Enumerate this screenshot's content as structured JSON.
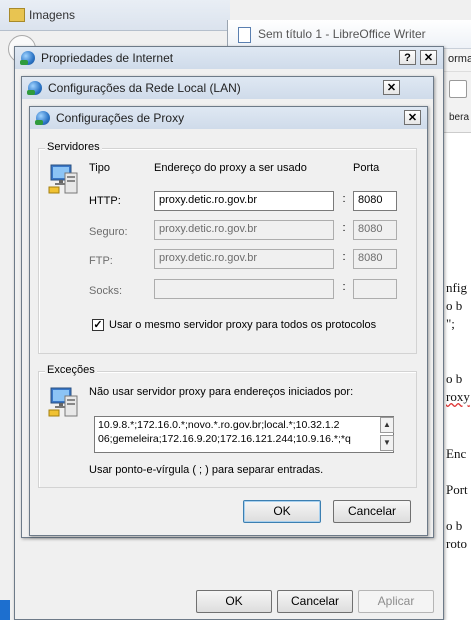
{
  "background": {
    "imagens_window": {
      "title": "Imagens"
    },
    "writer_window": {
      "title": "Sem título 1 - LibreOffice Writer",
      "menu_fragment": "orma",
      "toolbar_fragment": "bera",
      "document_fragments": [
        "nfig",
        "o b",
        "\";",
        "o b",
        "roxy",
        "Enc",
        "Port",
        "o b",
        "roto"
      ]
    }
  },
  "internet_properties": {
    "title": "Propriedades de Internet",
    "help_label": "?",
    "close_label": "✕",
    "ok_label": "OK",
    "cancel_label": "Cancelar",
    "apply_label": "Aplicar"
  },
  "lan_settings": {
    "title": "Configurações da Rede Local (LAN)",
    "close_label": "✕"
  },
  "proxy_settings": {
    "title": "Configurações de Proxy",
    "close_label": "✕",
    "servers": {
      "group_label": "Servidores",
      "col_type": "Tipo",
      "col_address": "Endereço do proxy a ser usado",
      "col_port": "Porta",
      "separator": ":",
      "rows": [
        {
          "type": "HTTP:",
          "address": "proxy.detic.ro.gov.br",
          "port": "8080",
          "enabled": true
        },
        {
          "type": "Seguro:",
          "address": "proxy.detic.ro.gov.br",
          "port": "8080",
          "enabled": false
        },
        {
          "type": "FTP:",
          "address": "proxy.detic.ro.gov.br",
          "port": "8080",
          "enabled": false
        },
        {
          "type": "Socks:",
          "address": "",
          "port": "",
          "enabled": false
        }
      ],
      "same_proxy_checked": true,
      "same_proxy_label": "Usar o mesmo servidor proxy para todos os protocolos"
    },
    "exceptions": {
      "group_label": "Exceções",
      "description": "Não usar servidor proxy para endereços iniciados por:",
      "line1": "10.9.8.*;172.16.0.*;novo.*.ro.gov.br;local.*;10.32.1.2",
      "line2": "06;gemeleira;172.16.9.20;172.16.121.244;10.9.16.*;*q",
      "hint": "Usar ponto-e-vírgula ( ; ) para separar entradas."
    },
    "ok_label": "OK",
    "cancel_label": "Cancelar"
  },
  "colors": {
    "titlebar": "#dfe8f3",
    "dialog_bg": "#f0f0f0",
    "default_button_border": "#3c7fb1"
  }
}
